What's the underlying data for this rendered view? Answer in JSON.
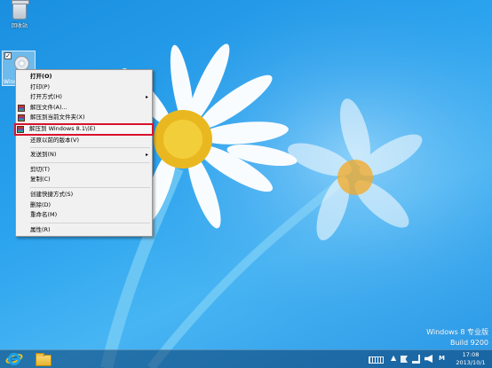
{
  "desktop": {
    "recycle_bin_label": "回收站",
    "iso_icon_label": "Wind"
  },
  "context_menu": {
    "items": [
      {
        "label": "打开(O)",
        "bold": true
      },
      {
        "label": "打印(P)"
      },
      {
        "label": "打开方式(H)",
        "submenu": true
      },
      {
        "label": "解压文件(A)...",
        "icon": "winrar-icon"
      },
      {
        "label": "解压到当前文件夹(X)",
        "icon": "winrar-icon"
      },
      {
        "label": "解压到 Windows 8.1\\(E)",
        "icon": "winrar-icon",
        "highlighted": true
      },
      {
        "label": "还原以前的版本(V)"
      },
      {
        "label": "发送到(N)",
        "submenu": true
      },
      {
        "label": "剪切(T)"
      },
      {
        "label": "复制(C)"
      },
      {
        "label": "创建快捷方式(S)"
      },
      {
        "label": "删除(D)"
      },
      {
        "label": "重命名(M)"
      },
      {
        "label": "属性(R)"
      }
    ],
    "submenu_arrow": "▸",
    "highlight_color": "#d9132d"
  },
  "watermark": {
    "line1": "Windows 8 专业版",
    "line2": "Build 9200"
  },
  "taskbar": {
    "time": "17:08",
    "date": "2013/10/1",
    "ime_label": "M",
    "tray_chevron": "▲"
  }
}
